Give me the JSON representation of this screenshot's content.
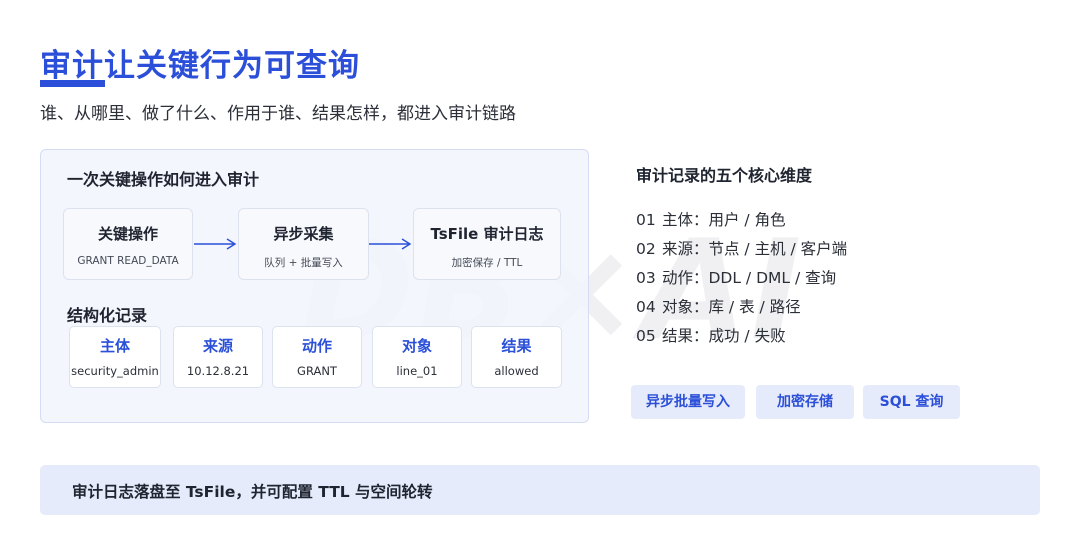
{
  "watermark": "DB×AI",
  "header": {
    "title": "审计让关键行为可查询",
    "subtitle": "谁、从哪里、做了什么、作用于谁、结果怎样，都进入审计链路"
  },
  "flow": {
    "title": "一次关键操作如何进入审计",
    "steps": [
      {
        "name": "关键操作",
        "sub": "GRANT READ_DATA"
      },
      {
        "name": "异步采集",
        "sub": "队列 + 批量写入"
      },
      {
        "name": "TsFile 审计日志",
        "sub": "加密保存 / TTL"
      }
    ]
  },
  "record": {
    "title": "结构化记录",
    "fields": [
      {
        "name": "主体",
        "value": "security_admin"
      },
      {
        "name": "来源",
        "value": "10.12.8.21"
      },
      {
        "name": "动作",
        "value": "GRANT"
      },
      {
        "name": "对象",
        "value": "line_01"
      },
      {
        "name": "结果",
        "value": "allowed"
      }
    ]
  },
  "dimensions": {
    "title": "审计记录的五个核心维度",
    "items": [
      {
        "num": "01",
        "text": "主体：用户 / 角色"
      },
      {
        "num": "02",
        "text": "来源：节点 / 主机 / 客户端"
      },
      {
        "num": "03",
        "text": "动作：DDL / DML / 查询"
      },
      {
        "num": "04",
        "text": "对象：库 / 表 / 路径"
      },
      {
        "num": "05",
        "text": "结果：成功 / 失败"
      }
    ]
  },
  "tags": [
    "异步批量写入",
    "加密存储",
    "SQL 查询"
  ],
  "footer": "审计日志落盘至 TsFile，并可配置 TTL 与空间轮转",
  "colors": {
    "accent": "#2b4fd8",
    "panel_bg": "#f1f4fd",
    "tag_bg": "#e6ebfb"
  }
}
